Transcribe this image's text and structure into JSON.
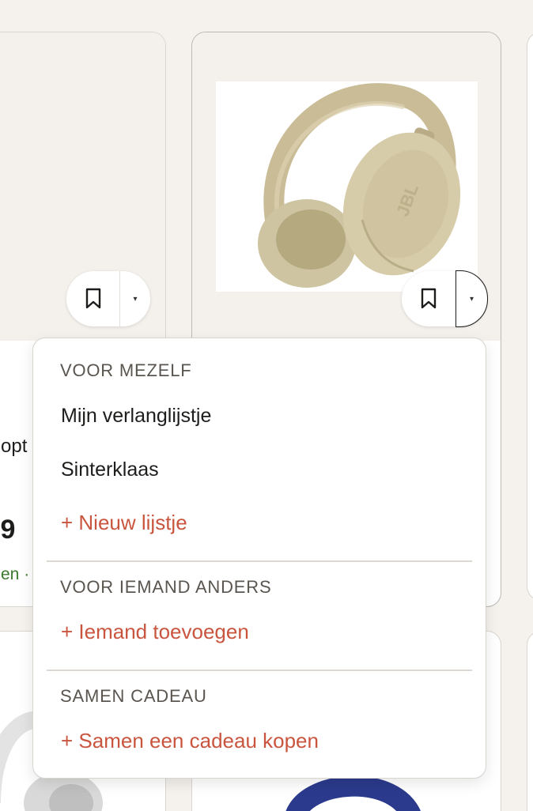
{
  "left_card": {
    "title_fragment": "opt",
    "price_fragment": ",9",
    "delivery_fragment": "en ·",
    "badge_color": "#c8442b"
  },
  "product_card": {
    "image_alt": "JBL over-ear koptelefoon beige",
    "brand_mark": "JBL"
  },
  "save_button": {
    "icon": "bookmark-icon",
    "arrow_icon": "caret-down-icon",
    "arrow_glyph": "▾"
  },
  "dropdown": {
    "sections": [
      {
        "title": "VOOR MEZELF",
        "items": [
          "Mijn verlanglijstje",
          "Sinterklaas"
        ],
        "add_label": "+ Nieuw lijstje"
      },
      {
        "title": "VOOR IEMAND ANDERS",
        "items": [],
        "add_label": "+ Iemand toevoegen"
      },
      {
        "title": "SAMEN CADEAU",
        "items": [],
        "add_label": "+ Samen een cadeau kopen"
      }
    ]
  },
  "colors": {
    "accent": "#c9553e",
    "background": "#f5f2ee",
    "delivery_green": "#3b7a2e"
  }
}
